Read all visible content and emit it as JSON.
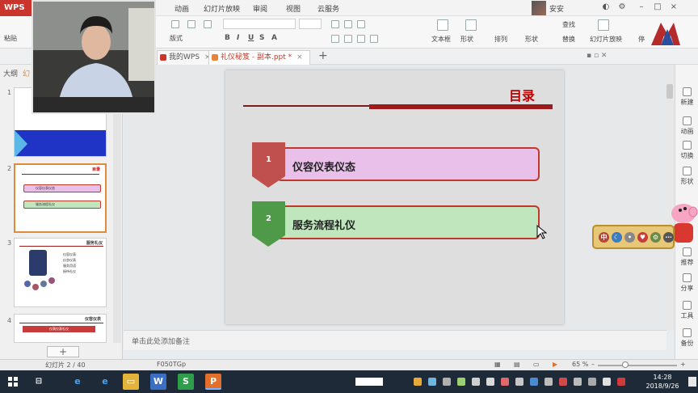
{
  "app": {
    "badge": "WPS"
  },
  "menu": [
    "动画",
    "幻灯片放映",
    "审阅",
    "视图",
    "云服务"
  ],
  "window": {
    "user_label": "安安"
  },
  "ribbon": {
    "paste_label": "粘贴",
    "format_label": "版式",
    "textbox_label": "文本框",
    "shape_label": "形状",
    "arrange_label": "排列",
    "shape_fill_label": "形状",
    "find_label": "查找",
    "replace_label": "替换",
    "play_label": "幻灯片放映",
    "stop_label": "停"
  },
  "tabs": [
    {
      "label": "我的WPS",
      "active": false
    },
    {
      "label": "礼仪秘笈 - 副本.ppt *",
      "active": true
    }
  ],
  "left_panel": {
    "tabs": [
      "大纲",
      "幻"
    ],
    "thumbs": [
      {
        "num": "1"
      },
      {
        "num": "2",
        "title": "目录",
        "items": [
          "仪容仪表仪态",
          "服务流程礼仪"
        ]
      },
      {
        "num": "3",
        "title": "服务礼仪",
        "bullets": [
          "仪容仪表",
          "仪态仪表",
          "服务用语",
          "接待礼仪"
        ]
      },
      {
        "num": "4",
        "title": "仪容仪表",
        "banner": "仪表仪表礼仪"
      }
    ]
  },
  "slide": {
    "title": "目录",
    "items": [
      {
        "num": "1",
        "label": "仪容仪表仪态",
        "color": "#e9c0ea",
        "tag_color": "#c0504d"
      },
      {
        "num": "2",
        "label": "服务流程礼仪",
        "color": "#bfe6bd",
        "tag_color": "#4e9a48"
      }
    ]
  },
  "notes_placeholder": "单击此处添加备注",
  "right_dock": [
    "新建",
    "动画",
    "切换",
    "形状",
    "推荐",
    "分享",
    "工具",
    "备份"
  ],
  "status": {
    "slide_pos": "幻灯片 2 / 40",
    "theme": "F050TGp",
    "zoom": "65 %"
  },
  "taskbar": {
    "time": "14:28",
    "date": "2018/9/26"
  },
  "colors": {
    "accent": "#c0392b",
    "title_red": "#c00000",
    "taskbar": "#1f2a38"
  }
}
